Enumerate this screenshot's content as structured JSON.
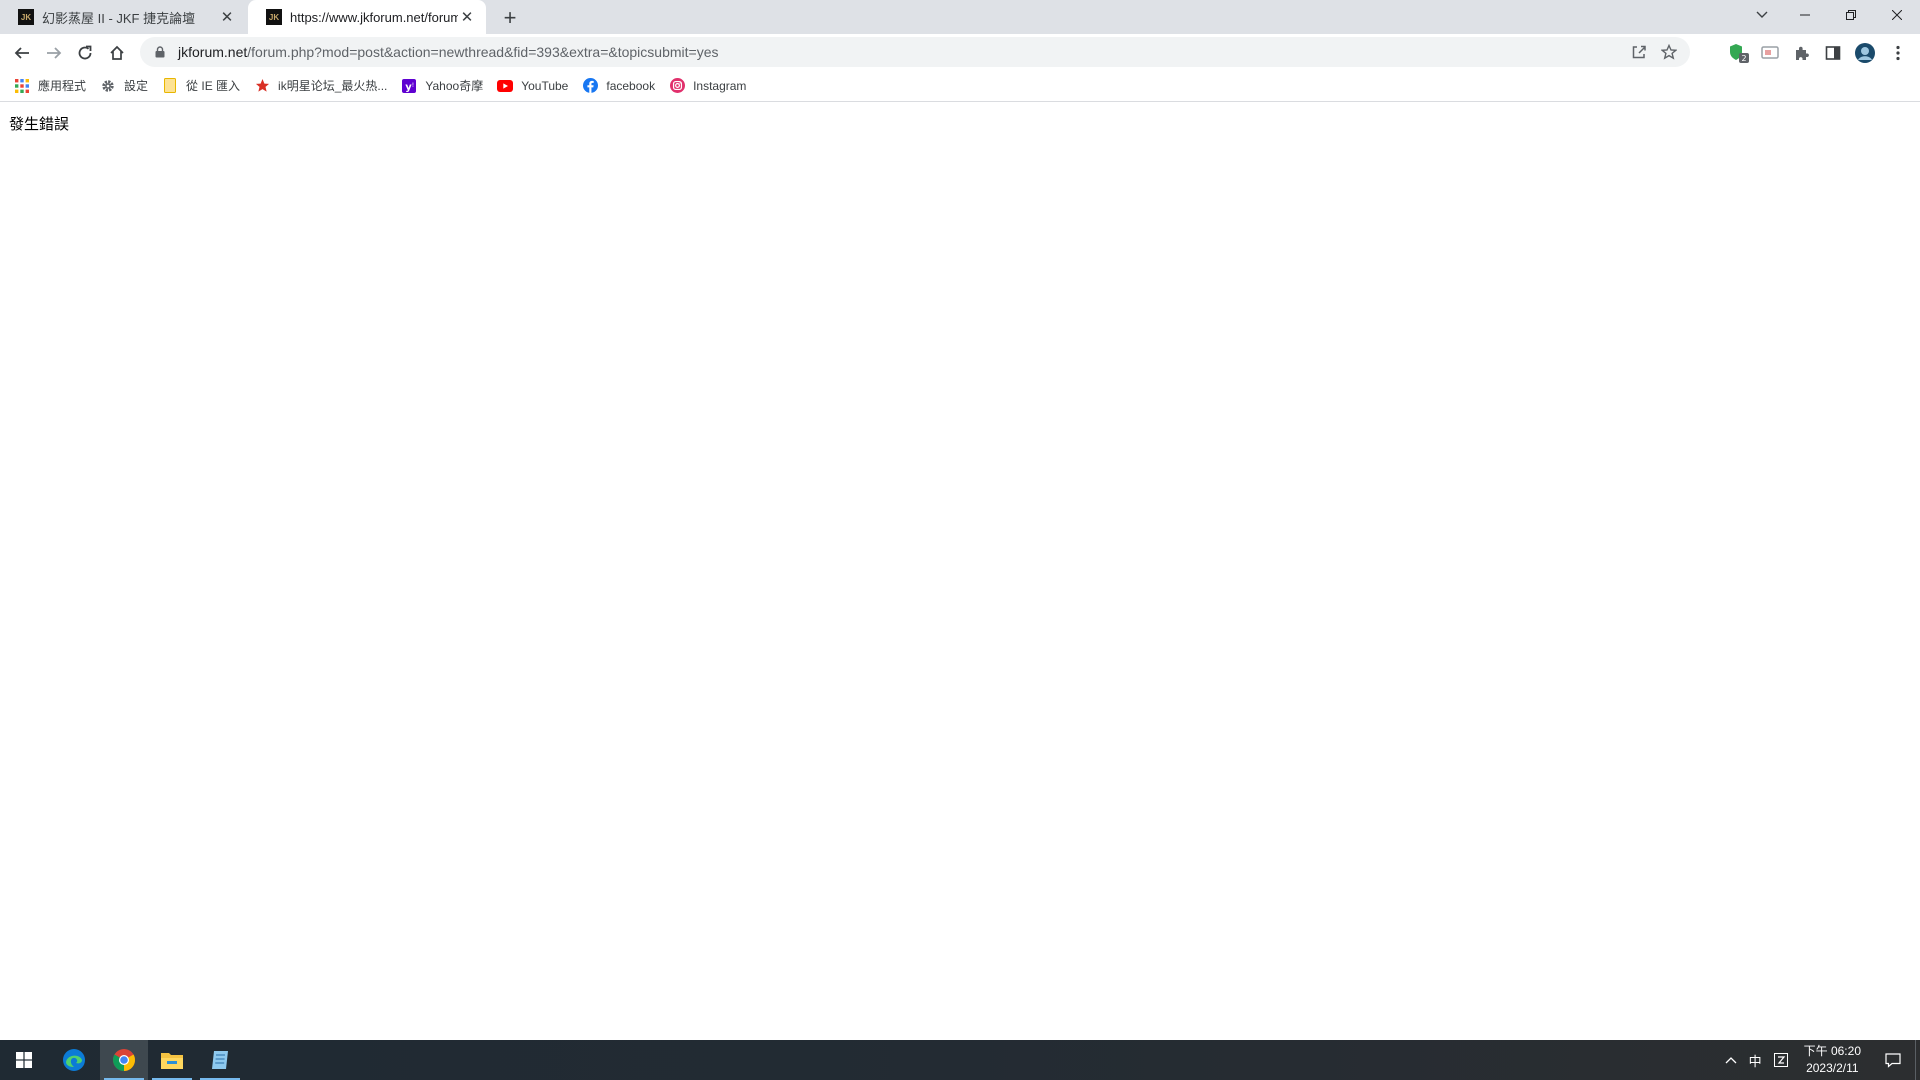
{
  "tabs": [
    {
      "title": "幻影蒸屋 II - JKF 捷克論壇",
      "favicon_text": "JK"
    },
    {
      "title": "https://www.jkforum.net/forum",
      "favicon_text": "JK"
    }
  ],
  "address_bar": {
    "host": "jkforum.net",
    "path": "/forum.php?mod=post&action=newthread&fid=393&extra=&topicsubmit=yes"
  },
  "extensions": {
    "badge_count": "2"
  },
  "bookmarks": [
    {
      "label": "應用程式",
      "icon": "apps-grid-icon"
    },
    {
      "label": "設定",
      "icon": "gear-icon"
    },
    {
      "label": "從 IE 匯入",
      "icon": "folder-icon"
    },
    {
      "label": "ik明星论坛_最火热...",
      "icon": "star-icon"
    },
    {
      "label": "Yahoo奇摩",
      "icon": "yahoo-icon"
    },
    {
      "label": "YouTube",
      "icon": "youtube-icon"
    },
    {
      "label": "facebook",
      "icon": "facebook-icon"
    },
    {
      "label": "Instagram",
      "icon": "instagram-icon"
    }
  ],
  "page": {
    "error_message": "發生錯誤"
  },
  "taskbar": {
    "ime_label": "中",
    "time": "下午 06:20",
    "date": "2023/2/11"
  },
  "colors": {
    "tabstrip": "#dee1e6",
    "omnibox": "#f1f3f4",
    "taskbar": "#232b33",
    "taskbar_indicator": "#76b9ed"
  }
}
